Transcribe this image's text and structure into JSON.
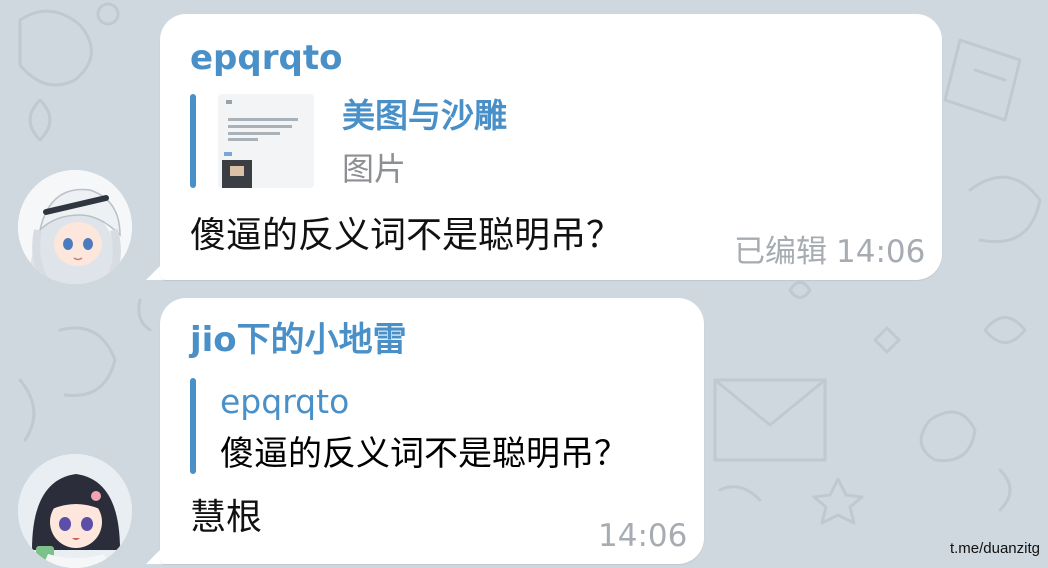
{
  "messages": [
    {
      "sender": "epqrqto",
      "quote": {
        "title": "美图与沙雕",
        "subtitle": "图片"
      },
      "text": "傻逼的反义词不是聪明吊？",
      "edited_label": "已编辑",
      "time": "14:06"
    },
    {
      "sender": "jio下的小地雷",
      "quote": {
        "title": "epqrqto",
        "text": "傻逼的反义词不是聪明吊？"
      },
      "text": "慧根",
      "time": "14:06"
    }
  ],
  "watermark": "t.me/duanzitg",
  "colors": {
    "background": "#cfd8df",
    "bubble": "#ffffff",
    "name": "#4a90c8",
    "meta": "#a6acb2"
  },
  "icons": [
    "avatar-anime-girl-white-hair",
    "avatar-anime-girl-dark-hair",
    "photo-thumbnail"
  ]
}
